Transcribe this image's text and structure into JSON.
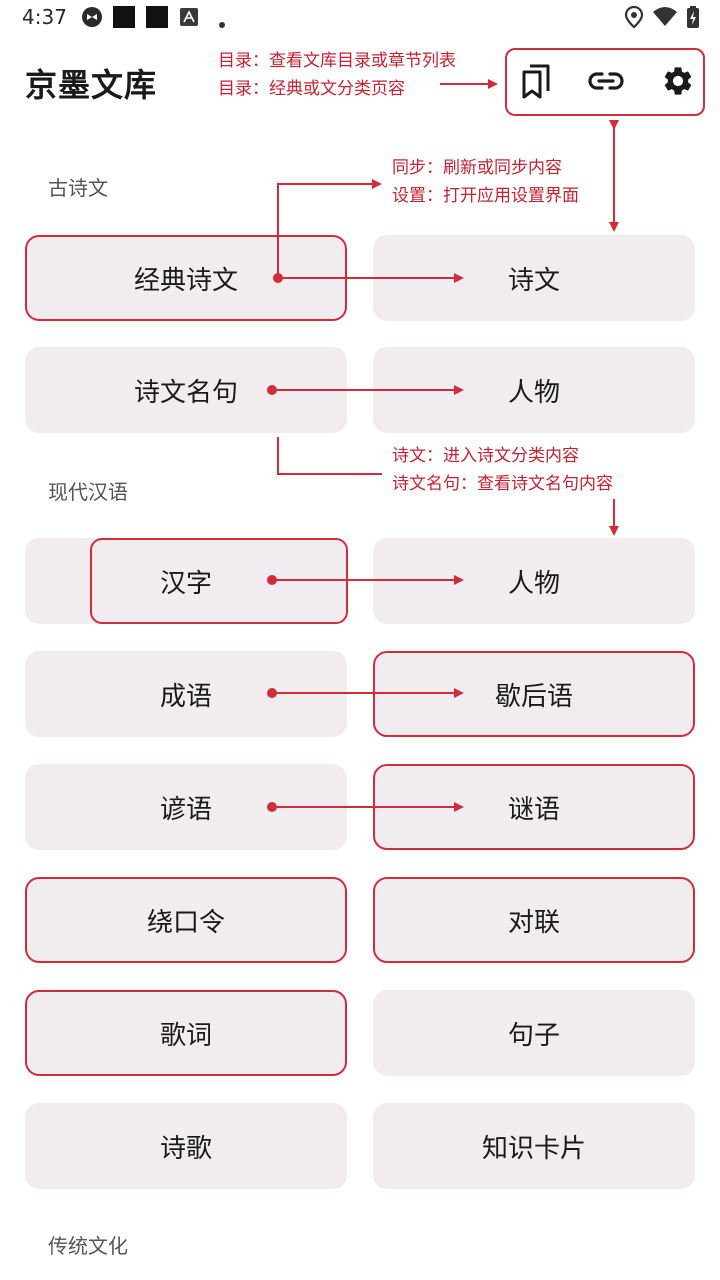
{
  "status_bar": {
    "time": "4:37"
  },
  "app": {
    "title": "京墨文库"
  },
  "toolbar": {
    "catalog_icon": "bookmark-copy-icon",
    "sync_icon": "link-icon",
    "settings_icon": "gear-icon"
  },
  "sections": [
    {
      "label": "古诗文"
    },
    {
      "label": "现代汉语"
    },
    {
      "label": "传统文化"
    }
  ],
  "cards": [
    {
      "label": "经典诗文"
    },
    {
      "label": "诗文"
    },
    {
      "label": "诗文名句"
    },
    {
      "label": "人物"
    },
    {
      "label": "汉字"
    },
    {
      "label": "人物"
    },
    {
      "label": "成语"
    },
    {
      "label": "歇后语"
    },
    {
      "label": "谚语"
    },
    {
      "label": "谜语"
    },
    {
      "label": "绕口令"
    },
    {
      "label": "对联"
    },
    {
      "label": "歌词"
    },
    {
      "label": "句子"
    },
    {
      "label": "诗歌"
    },
    {
      "label": "知识卡片"
    }
  ],
  "annotations": {
    "top_line1": "目录：查看文库目录或章节列表",
    "top_line2": "目录：经典或文分类页容",
    "sync_line1": "同步：刷新或同步内容",
    "sync_line2": "设置：打开应用设置界面",
    "poem_line1": "诗文：进入诗文分类内容",
    "poem_line2": "诗文名句：查看诗文名句内容"
  },
  "colors": {
    "accent_red": "#d12c3a",
    "card_bg": "#f1ecef"
  }
}
